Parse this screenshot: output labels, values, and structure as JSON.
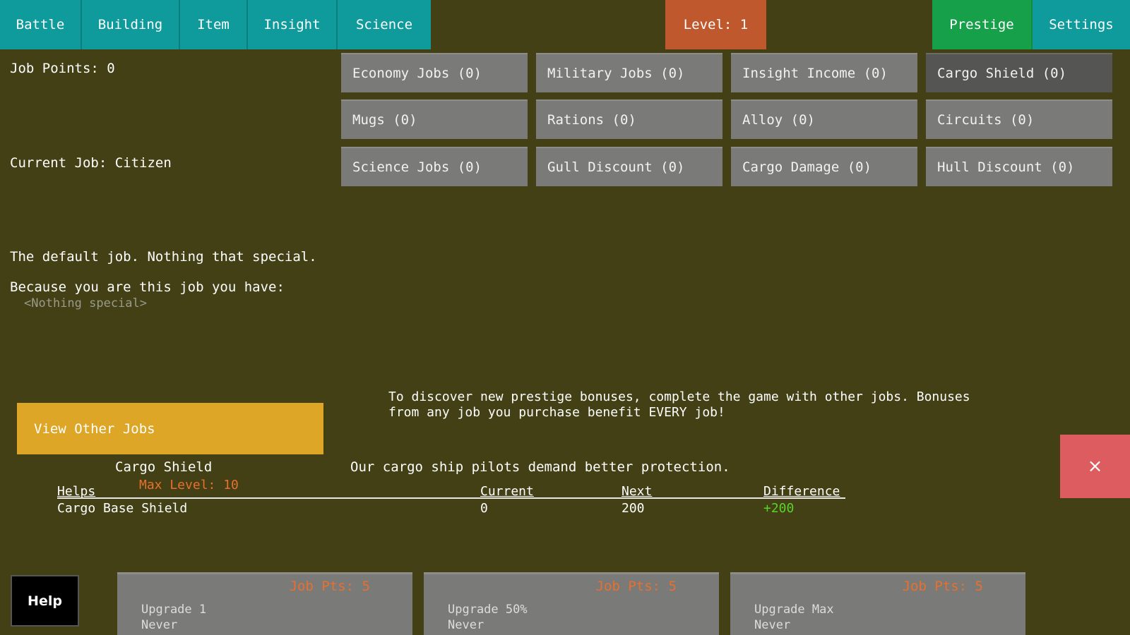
{
  "tabs": {
    "battle": "Battle",
    "building": "Building",
    "item": "Item",
    "insight": "Insight",
    "science": "Science",
    "level": "Level: 1",
    "prestige": "Prestige",
    "settings": "Settings"
  },
  "job_points": "Job Points: 0",
  "current_job": "Current Job: Citizen",
  "job_description": "The default job. Nothing that special.",
  "job_benefits_heading": "Because you are this job you have:",
  "job_benefits_value": "<Nothing special>",
  "view_other_jobs": "View Other Jobs",
  "prestige_buttons": [
    "Economy Jobs (0)",
    "Military Jobs (0)",
    "Insight Income (0)",
    "Cargo Shield (0)",
    "Mugs (0)",
    "Rations (0)",
    "Alloy (0)",
    "Circuits (0)",
    "Science Jobs (0)",
    "Gull Discount (0)",
    "Cargo Damage (0)",
    "Hull Discount (0)"
  ],
  "discover_text_line1": "To discover new prestige bonuses, complete the game with other jobs. Bonuses",
  "discover_text_line2": "from any job you purchase benefit EVERY job!",
  "detail": {
    "name": "Cargo Shield",
    "max_level": "Max Level: 10",
    "description": "Our cargo ship pilots demand better protection.",
    "headers": {
      "helps": "Helps",
      "current": "Current",
      "next": "Next",
      "difference": "Difference"
    },
    "row": {
      "helps": "Cargo Base Shield",
      "current": "0",
      "next": "200",
      "difference": "+200"
    }
  },
  "close_symbol": "×",
  "help": "Help",
  "upgrades": [
    {
      "cost": "Job Pts: 5",
      "label": "Upgrade 1",
      "sub": "Never"
    },
    {
      "cost": "Job Pts: 5",
      "label": "Upgrade 50%",
      "sub": "Never"
    },
    {
      "cost": "Job Pts: 5",
      "label": "Upgrade Max",
      "sub": "Never"
    }
  ],
  "colors": {
    "background": "#424014",
    "tab": "#0f9a9b",
    "level": "#c0582d",
    "prestige_active": "#17a04a",
    "view_jobs": "#dda626",
    "close": "#dd5c60",
    "orange_text": "#e8702e",
    "green_text": "#5ad22c"
  }
}
